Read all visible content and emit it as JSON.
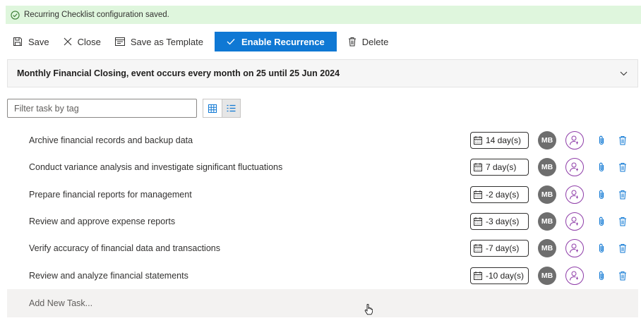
{
  "banner": {
    "message": "Recurring Checklist configuration saved."
  },
  "toolbar": {
    "save_label": "Save",
    "close_label": "Close",
    "save_template_label": "Save as Template",
    "enable_recurrence_label": "Enable Recurrence",
    "delete_label": "Delete"
  },
  "event": {
    "title": "Monthly Financial Closing, event occurs every month on 25 until 25 Jun 2024"
  },
  "filter": {
    "placeholder": "Filter task by tag",
    "value": ""
  },
  "tasks": [
    {
      "name": "Archive financial records and backup data",
      "due": "14 day(s)",
      "assignee_initials": "MB"
    },
    {
      "name": "Conduct variance analysis and investigate significant fluctuations",
      "due": "7 day(s)",
      "assignee_initials": "MB"
    },
    {
      "name": "Prepare financial reports for management",
      "due": "-2 day(s)",
      "assignee_initials": "MB"
    },
    {
      "name": "Review and approve expense reports",
      "due": "-3 day(s)",
      "assignee_initials": "MB"
    },
    {
      "name": "Verify accuracy of financial data and transactions",
      "due": "-7 day(s)",
      "assignee_initials": "MB"
    },
    {
      "name": "Review and analyze financial statements",
      "due": "-10 day(s)",
      "assignee_initials": "MB"
    }
  ],
  "add_task": {
    "placeholder": "Add New Task..."
  },
  "icons": {
    "banner": "check-circle-icon",
    "save": "save-icon",
    "close": "close-icon",
    "template": "template-icon",
    "enable": "checkmark-icon",
    "delete": "trash-icon",
    "chevron": "chevron-down-icon",
    "grid_view": "grid-view-icon",
    "list_view": "list-view-icon",
    "calendar": "calendar-icon",
    "assign": "assign-person-icon",
    "attach": "paperclip-icon",
    "row_delete": "trash-icon"
  },
  "colors": {
    "primary": "#0f78d4",
    "banner_bg": "#dff6dd",
    "avatar_bg": "#6e6e6e",
    "assign_accent": "#8e3ca8",
    "attach_blue": "#0f78d4"
  }
}
